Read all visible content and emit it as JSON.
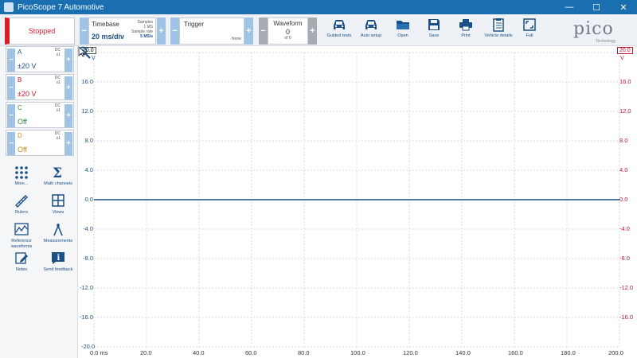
{
  "window": {
    "title": "PicoScope 7 Automotive",
    "minimize": "—",
    "maximize": "☐",
    "close": "✕"
  },
  "run": {
    "status": "Stopped"
  },
  "timebase": {
    "label": "Timebase",
    "value": "20 ms/div",
    "samples_label": "Samples",
    "samples": "1 MS",
    "rate_label": "Sample rate",
    "rate": "5 MS/s"
  },
  "trigger": {
    "label": "Trigger",
    "mode": "None"
  },
  "waveform": {
    "label": "Waveform",
    "current": "0",
    "total": "of 0"
  },
  "toolbar": [
    {
      "label": "Guided tests",
      "icon": "car-icon"
    },
    {
      "label": "Auto setup",
      "icon": "car-auto-icon"
    },
    {
      "label": "Open",
      "icon": "folder-icon"
    },
    {
      "label": "Save",
      "icon": "save-icon"
    },
    {
      "label": "Print",
      "icon": "print-icon"
    },
    {
      "label": "Vehicle details",
      "icon": "clipboard-icon"
    },
    {
      "label": "Full",
      "icon": "fullscreen-icon"
    }
  ],
  "brand": {
    "logo": "pico",
    "tagline": "Technology"
  },
  "channels": [
    {
      "name": "A",
      "coupling": "DC",
      "probe": "x1",
      "range": "±20 V",
      "color": "#1a4f87"
    },
    {
      "name": "B",
      "coupling": "DC",
      "probe": "x1",
      "range": "±20 V",
      "color": "#c01530"
    },
    {
      "name": "C",
      "coupling": "DC",
      "probe": "x1",
      "range": "Off",
      "color": "#2e8b3e"
    },
    {
      "name": "D",
      "coupling": "DC",
      "probe": "x1",
      "range": "Off",
      "color": "#c98a1d"
    }
  ],
  "left_tools": [
    {
      "label": "More...",
      "icon": "grid-dots-icon"
    },
    {
      "label": "Math channels",
      "icon": "sigma-icon"
    },
    {
      "label": "Rulers",
      "icon": "ruler-icon"
    },
    {
      "label": "Views",
      "icon": "views-icon"
    },
    {
      "label": "Reference waveforms",
      "icon": "reference-waveform-icon"
    },
    {
      "label": "Measurements",
      "icon": "compass-icon"
    },
    {
      "label": "Notes",
      "icon": "notes-icon"
    },
    {
      "label": "Send feedback",
      "icon": "info-icon"
    }
  ],
  "scope": {
    "y_ticks_left": [
      "16.0",
      "12.0",
      "8.0",
      "4.0",
      "0.0",
      "-4.0",
      "-8.0",
      "-12.0",
      "-16.0"
    ],
    "y_ticks_right": [
      "16.0",
      "12.0",
      "8.0",
      "4.0",
      "0.0",
      "-4.0",
      "-8.0",
      "-12.0",
      "-16.0"
    ],
    "y_max_left": "20.0",
    "y_max_right": "20.0",
    "y_min_left": "-20.0",
    "y_unit_left": "V",
    "y_unit_right": "V",
    "x_ticks": [
      "0.0 ms",
      "20.0",
      "40.0",
      "60.0",
      "80.0",
      "100.0",
      "120.0",
      "140.0",
      "160.0",
      "180.0",
      "200.0"
    ],
    "trace_level_v": 0.0,
    "colors": {
      "left_axis": "#1a4f87",
      "right_axis": "#c01530",
      "trace": "#1a4f87"
    }
  }
}
